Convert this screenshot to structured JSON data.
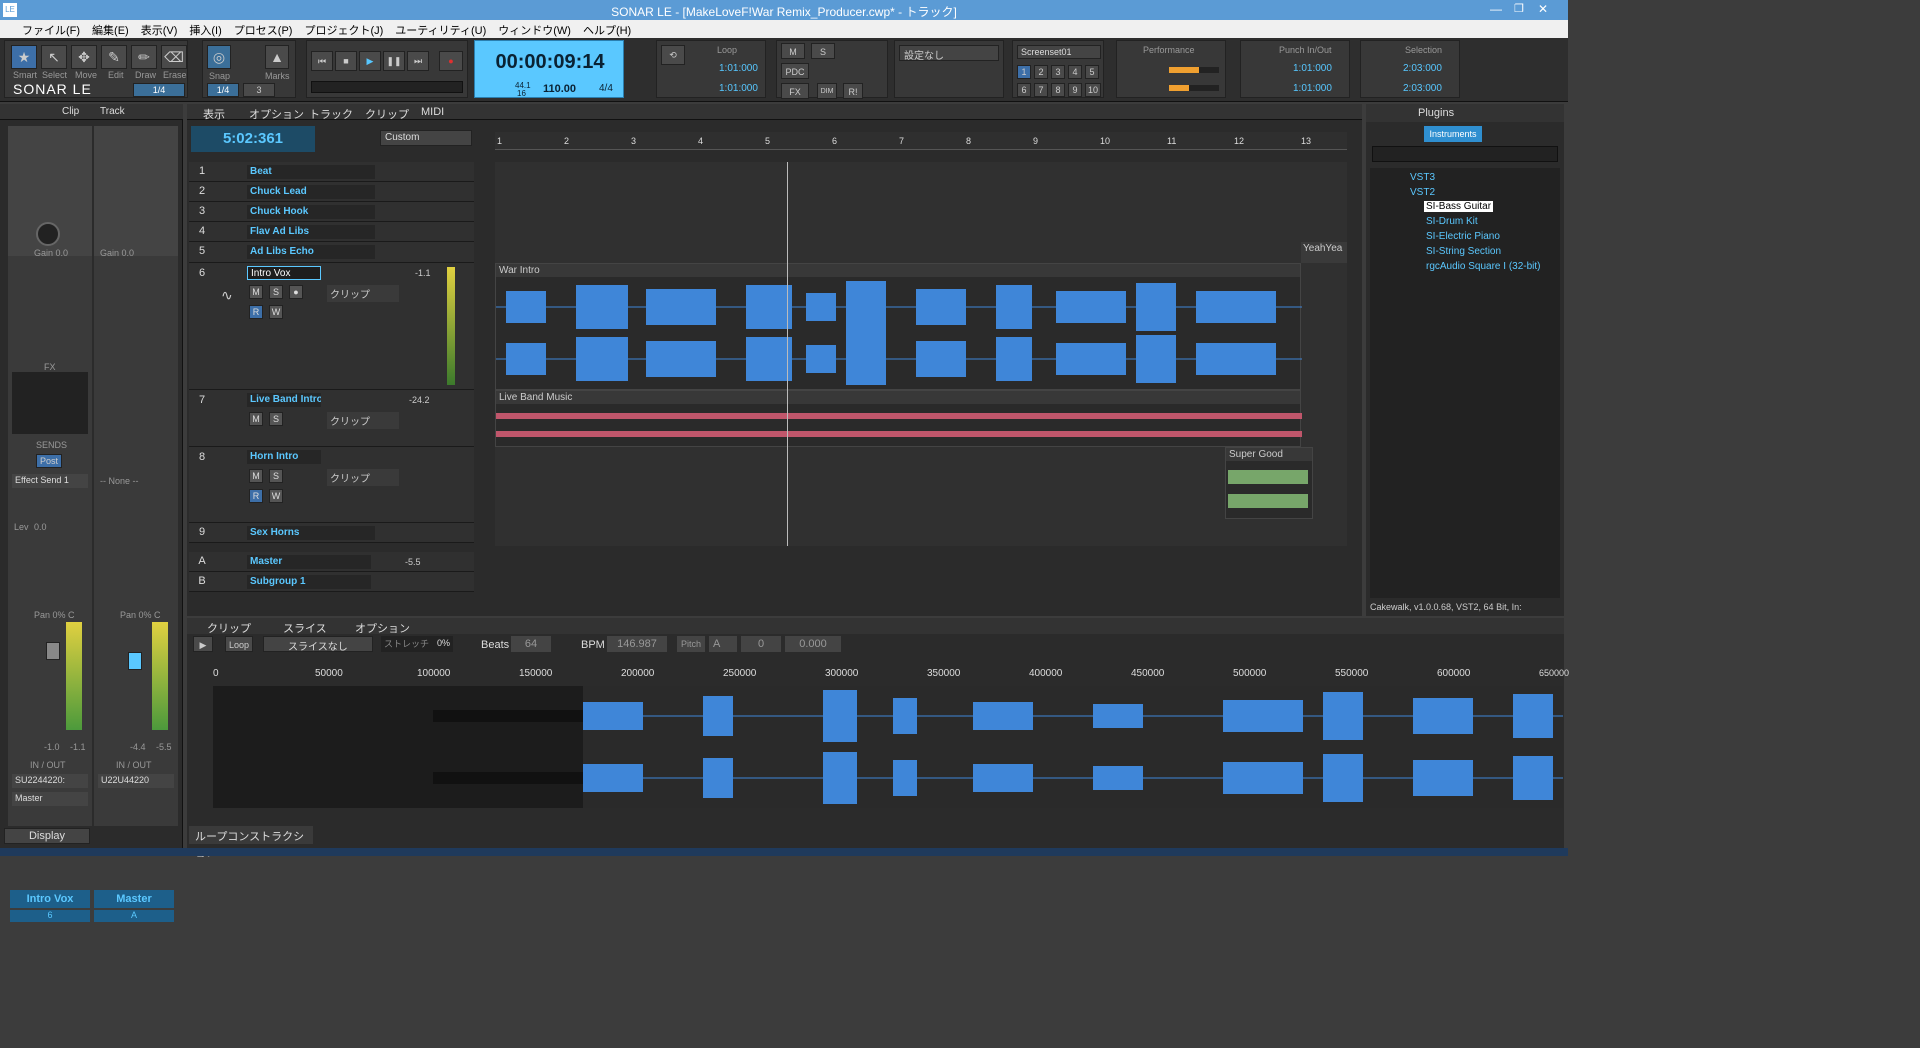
{
  "window": {
    "title": "SONAR LE - [MakeLoveF!War Remix_Producer.cwp* - トラック]"
  },
  "menu": [
    "ファイル(F)",
    "編集(E)",
    "表示(V)",
    "挿入(I)",
    "プロセス(P)",
    "プロジェクト(J)",
    "ユーティリティ(U)",
    "ウィンドウ(W)",
    "ヘルプ(H)"
  ],
  "tools": {
    "labels": [
      "Smart",
      "Select",
      "Move",
      "Edit",
      "Draw",
      "Erase"
    ],
    "brand": "SONAR LE",
    "snap_value": "1/4",
    "snap": "Snap",
    "marks": "Marks",
    "snap_small": "1/4",
    "snap_num": "3"
  },
  "transport": {
    "time": "00:00:09:14",
    "bpm": "110.00",
    "meter": "4/4",
    "rate1": "44.1",
    "rate2": "16"
  },
  "loop": {
    "label": "Loop",
    "start": "1:01:000",
    "end": "1:01:000"
  },
  "mix": {
    "m": "M",
    "s": "S",
    "pdc": "PDC",
    "fx": "FX",
    "dim": "DIM",
    "rl": "R!"
  },
  "preset": "設定なし",
  "screenset": {
    "label": "Screenset01",
    "nums": [
      "1",
      "2",
      "3",
      "4",
      "5",
      "6",
      "7",
      "8",
      "9",
      "10"
    ]
  },
  "performance": {
    "label": "Performance"
  },
  "punch": {
    "label": "Punch In/Out",
    "start": "1:01:000",
    "end": "1:01:000"
  },
  "selection": {
    "label": "Selection",
    "start": "2:03:000",
    "end": "2:03:000"
  },
  "inspector": {
    "tabs": [
      "Clip",
      "Track"
    ],
    "gain1": "Gain 0.0",
    "gain2": "Gain 0.0",
    "pan": "Pan",
    "pan_c": "C",
    "fx": "FX",
    "sends": "SENDS",
    "post": "Post",
    "effect_send": "Effect Send 1",
    "none": "-- None --",
    "lev": "Lev",
    "lev_val": "0.0",
    "pan1": "Pan 0% C",
    "pan2": "Pan 0% C",
    "fader1": [
      "-1.0",
      "-1.1"
    ],
    "fader2": [
      "-4.4",
      "-5.5"
    ],
    "io": "IN / OUT",
    "in1": "SU2244220:",
    "in2": "U22U44220",
    "out1": "Master",
    "strip1": "Intro Vox",
    "strip1_num": "6",
    "strip2": "Master",
    "strip2_num": "A",
    "display": "Display"
  },
  "trackview": {
    "menus": [
      "表示",
      "オプション",
      "トラック",
      "クリップ",
      "MIDI"
    ],
    "now": "5:02:361",
    "custom": "Custom",
    "ruler": [
      "1",
      "2",
      "3",
      "4",
      "5",
      "6",
      "7",
      "8",
      "9",
      "10",
      "11",
      "12",
      "13"
    ]
  },
  "tracks": [
    {
      "num": "1",
      "name": "Beat"
    },
    {
      "num": "2",
      "name": "Chuck Lead"
    },
    {
      "num": "3",
      "name": "Chuck Hook"
    },
    {
      "num": "4",
      "name": "Flav Ad Libs"
    },
    {
      "num": "5",
      "name": "Ad Libs Echo"
    },
    {
      "num": "6",
      "name": "Intro Vox",
      "vol": "-1.1",
      "clip": "クリップ"
    },
    {
      "num": "7",
      "name": "Live Band Intro",
      "vol": "-24.2",
      "clip": "クリップ"
    },
    {
      "num": "8",
      "name": "Horn Intro",
      "clip": "クリップ"
    },
    {
      "num": "9",
      "name": "Sex Horns"
    }
  ],
  "buses": [
    {
      "num": "A",
      "name": "Master",
      "vol": "-5.5"
    },
    {
      "num": "B",
      "name": "Subgroup 1"
    }
  ],
  "clips": {
    "war_intro": "War Intro",
    "live_band": "Live Band Music",
    "super_good": "Super Good",
    "yeah": "YeahYea"
  },
  "browser": {
    "tab": "Plugins",
    "instruments": "Instruments",
    "tree": [
      {
        "label": "VST3",
        "level": 0
      },
      {
        "label": "VST2",
        "level": 0
      },
      {
        "label": "SI-Bass Guitar",
        "level": 1,
        "selected": true
      },
      {
        "label": "SI-Drum Kit",
        "level": 1
      },
      {
        "label": "SI-Electric Piano",
        "level": 1
      },
      {
        "label": "SI-String Section",
        "level": 1
      },
      {
        "label": "rgcAudio Square I (32-bit)",
        "level": 1
      }
    ],
    "status": "Cakewalk, v1.0.0.68, VST2, 64 Bit, In:"
  },
  "loopc": {
    "menus": [
      "クリップ",
      "スライス",
      "オプション"
    ],
    "loop": "Loop",
    "slice": "スライスなし",
    "stretch": "ストレッチ",
    "pct": "0%",
    "beats_l": "Beats",
    "beats": "64",
    "bpm_l": "BPM",
    "bpm": "146.987",
    "pitch": "Pitch",
    "a": "A",
    "zero": "0",
    "fine": "0.000",
    "ruler": [
      "0",
      "50000",
      "100000",
      "150000",
      "200000",
      "250000",
      "300000",
      "350000",
      "400000",
      "450000",
      "500000",
      "550000",
      "600000",
      "650000"
    ],
    "tab": "ループコンストラクション"
  },
  "colors": {
    "accent": "#57c7ff",
    "wave": "#3f86d8",
    "pink": "#c0566b",
    "green": "#77a66a"
  }
}
